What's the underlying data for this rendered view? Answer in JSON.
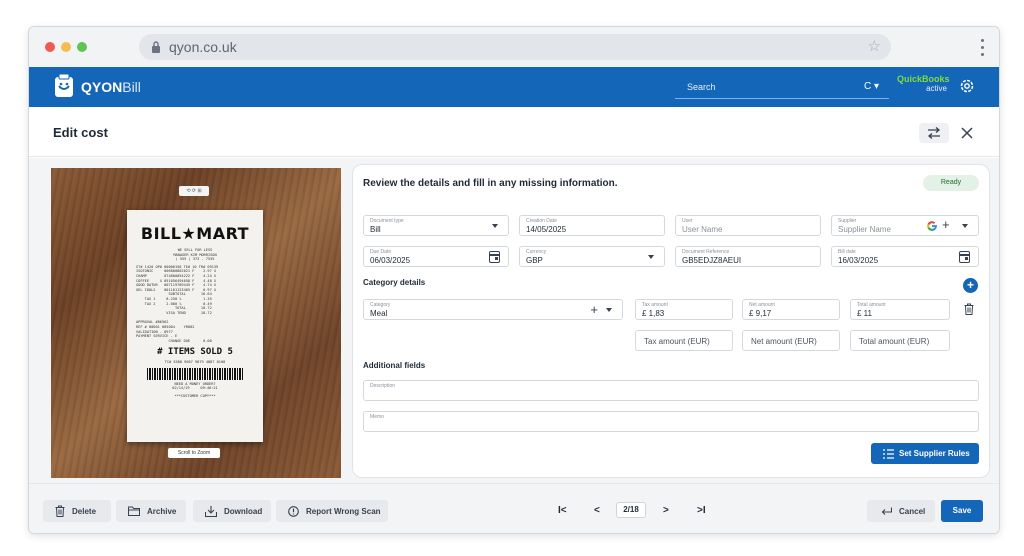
{
  "browser": {
    "url": "qyon.co.uk",
    "dot_colors": [
      "#ee5a52",
      "#f5bd4f",
      "#5fc453"
    ]
  },
  "appbar": {
    "logo_bold": "QYON",
    "logo_light": "Bill",
    "search_placeholder": "Search",
    "search_ctrl": "C ▾",
    "quickbooks_title": "QuickBooks",
    "quickbooks_status": "active"
  },
  "page": {
    "title": "Edit cost"
  },
  "receipt": {
    "brand": "BILL★MART",
    "tagline": "WE SELL FOR LESS\nMANAGER KIM MORRISON\n( 555 ) 373 - 7535",
    "lines": "ST# 1420 OP# 00000158 TE# 10 TR# 09139\nISOTONIC     006800802621 F    2.97 X\nCHAMP        074800054222 F    4.24 X\nCOFFEE     X 051056494658 F    4.48 X\nGOOD DATUR   007119789445 F    4.74 X\nGEL IDOLS    001101123465 F    0.97 X\n               SUBTOTAL       16.64\n    TAX 1     8.250 %          1.35\n    TAX 2     2.000 %          0.49\n                  TOTAL       18.72\n              VISA TEND       18.72",
    "lines2": "APPROVAL #86562\nREF # 00001 005004    YR002\nVALIDATION - 8977\nPAYMENT SERVICE - E\n               CHANGE DUE      0.00",
    "items_sold": "# ITEMS SOLD 5",
    "tc_line": "TC# 5588 9667 9879 4887 0108",
    "bottom": "NEED A MONEY ORDER?\n02/14/19     09:46:21",
    "copy": "***CUSTOMER COPY***",
    "tools": "⟲ ⟳ ⊞",
    "scroll_zoom": "Scroll to Zoom"
  },
  "form": {
    "intro": "Review the details and fill in any missing information.",
    "status": "Ready",
    "document_type": {
      "label": "Document type",
      "value": "Bill"
    },
    "creation_date": {
      "label": "Creation Date",
      "value": "14/05/2025"
    },
    "user": {
      "label": "User",
      "placeholder": "User Name"
    },
    "supplier": {
      "label": "Supplier",
      "placeholder": "Supplier Name"
    },
    "due_date": {
      "label": "Due Date",
      "value": "06/03/2025"
    },
    "currency": {
      "label": "Currency",
      "value": "GBP"
    },
    "doc_reference": {
      "label": "Document Reference",
      "value": "GB5EDJZ8AEUI"
    },
    "bill_date": {
      "label": "Bill date",
      "value": "16/03/2025"
    },
    "category_section": "Category details",
    "category": {
      "label": "Category",
      "value": "Meal"
    },
    "tax_amount": {
      "label": "Tax amount",
      "value": "£ 1,83"
    },
    "net_amount": {
      "label": "Net amount",
      "value": "£ 9,17"
    },
    "total_amount": {
      "label": "Total amount",
      "value": "£ 11"
    },
    "tax_eur": "Tax amount (EUR)",
    "net_eur": "Net amount (EUR)",
    "total_eur": "Total amount (EUR)",
    "additional_section": "Additional fields",
    "description": {
      "label": "Description"
    },
    "memo": {
      "label": "Memo"
    },
    "supplier_rules": "Set Supplier Rules"
  },
  "footer": {
    "delete": "Delete",
    "archive": "Archive",
    "download": "Download",
    "report": "Report Wrong Scan",
    "first": "I<",
    "prev": "<",
    "page": "2/18",
    "next": ">",
    "last": ">I",
    "cancel": "Cancel",
    "save": "Save"
  },
  "colors": {
    "brand_blue": "#1466b8",
    "quickbooks_green": "#7ddc3c"
  }
}
